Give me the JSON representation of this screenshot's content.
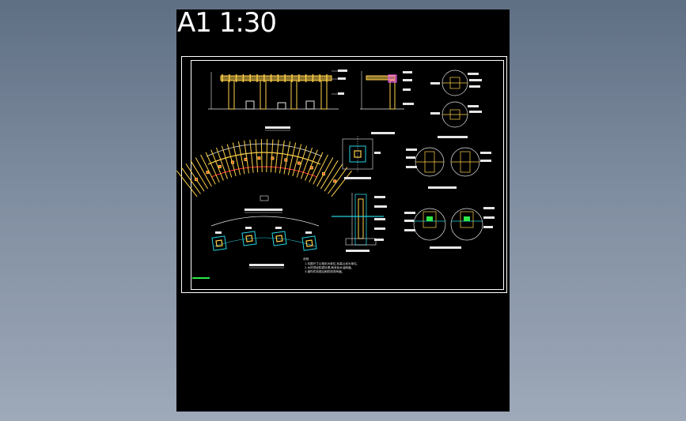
{
  "viewport": {
    "scale_label": "A1 1:30",
    "background": "#000000"
  },
  "drawing": {
    "frame_color": "#ffffff",
    "line_colors": {
      "structure": "#ffd24a",
      "cyan": "#22d3e0",
      "green": "#2ee84a",
      "red": "#ff3030",
      "white": "#e6e6e6",
      "magenta": "#ff5cff"
    },
    "notes_header": "说明",
    "notes": [
      "1.本图尺寸以毫米为单位,标高以米为单位。",
      "2.木材须经防腐处理,刷深色木油两遍。",
      "3.钢构件除锈后刷防锈漆两遍。"
    ]
  }
}
